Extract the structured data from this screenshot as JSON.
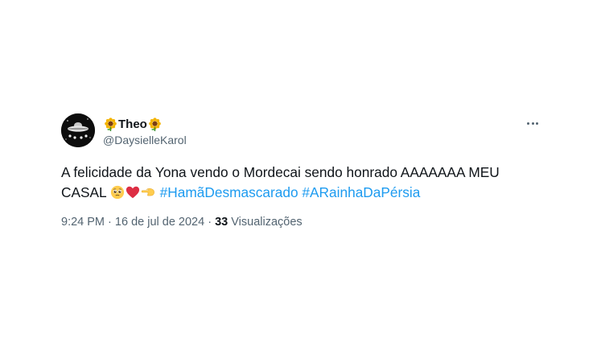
{
  "author": {
    "display_name": "Theo",
    "handle": "@DaysielleKarol",
    "avatar_icon": "ufo-galaxy-avatar",
    "name_emoji": "sunflower-icon"
  },
  "tweet": {
    "text_line1": "A felicidade da Yona vendo o Mordecai sendo honrado AAAAAAA MEU",
    "text_line2_prefix": "CASAL",
    "emojis": [
      "pleading-face-icon",
      "red-heart-icon",
      "backhand-pointing-left-icon"
    ],
    "hashtags": [
      "#HamãDesmascarado",
      "#ARainhaDaPérsia"
    ]
  },
  "meta": {
    "time": "9:24 PM",
    "separator": "·",
    "date": "16 de jul de 2024",
    "views_count": "33",
    "views_label": "Visualizações"
  },
  "colors": {
    "link": "#1d9bf0",
    "secondary_text": "#536471",
    "primary_text": "#0f1419"
  }
}
